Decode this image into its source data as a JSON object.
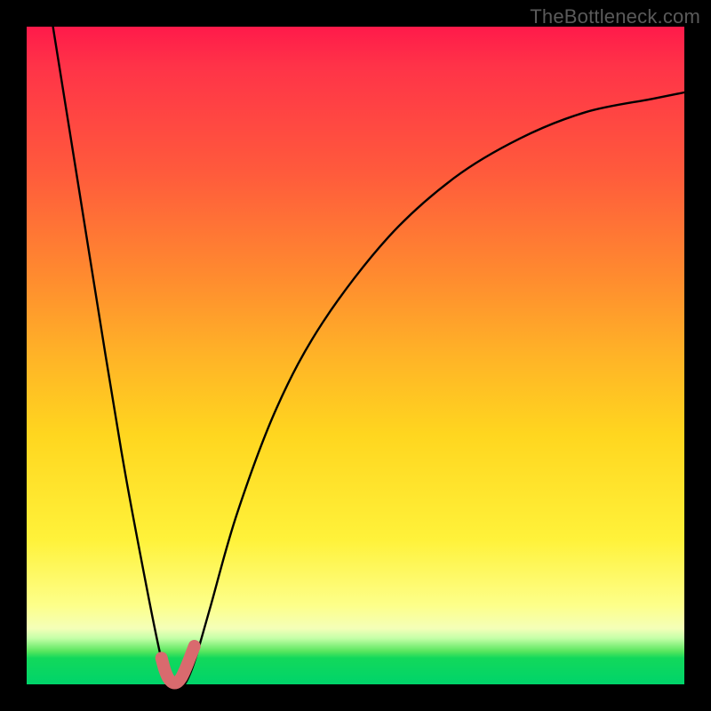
{
  "watermark": {
    "text": "TheBottleneck.com"
  },
  "chart_data": {
    "type": "line",
    "title": "",
    "xlabel": "",
    "ylabel": "",
    "xlim": [
      0,
      100
    ],
    "ylim": [
      0,
      100
    ],
    "grid": false,
    "legend": false,
    "series": [
      {
        "name": "bottleneck-curve",
        "x": [
          4,
          8,
          12,
          15,
          18,
          20,
          21,
          22,
          23,
          24,
          25,
          26,
          28,
          32,
          38,
          45,
          55,
          65,
          75,
          85,
          95,
          100
        ],
        "values": [
          100,
          75,
          50,
          32,
          16,
          6,
          2,
          0,
          0,
          0,
          2,
          5,
          12,
          26,
          42,
          55,
          68,
          77,
          83,
          87,
          89,
          90
        ]
      },
      {
        "name": "valley-marker",
        "x": [
          20.5,
          21.0,
          21.5,
          22.0,
          22.5,
          23.0,
          23.5,
          24.0,
          24.5,
          25.0,
          25.5
        ],
        "values": [
          4.0,
          2.2,
          1.0,
          0.4,
          0.2,
          0.4,
          1.0,
          2.0,
          3.2,
          4.5,
          5.8
        ]
      }
    ],
    "colors": {
      "curve": "#000000",
      "marker": "#d96a6e",
      "gradient_top": "#ff1a4a",
      "gradient_mid": "#ffd61f",
      "gradient_bottom": "#00d46a"
    }
  }
}
